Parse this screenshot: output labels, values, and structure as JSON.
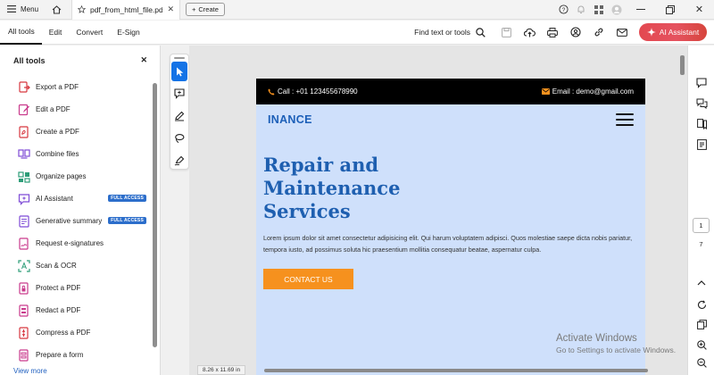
{
  "titlebar": {
    "menu_label": "Menu",
    "tab_title": "pdf_from_html_file.pdf",
    "create_label": "Create"
  },
  "toolbar": {
    "menu": [
      "All tools",
      "Edit",
      "Convert",
      "E-Sign"
    ],
    "find_label": "Find text or tools",
    "ai_label": "AI Assistant"
  },
  "left_panel": {
    "title": "All tools",
    "tools": [
      {
        "label": "Export a PDF",
        "icon": "export-pdf-icon",
        "color": "#d7373f"
      },
      {
        "label": "Edit a PDF",
        "icon": "edit-pdf-icon",
        "color": "#c93a8c"
      },
      {
        "label": "Create a PDF",
        "icon": "create-pdf-icon",
        "color": "#d7373f"
      },
      {
        "label": "Combine files",
        "icon": "combine-files-icon",
        "color": "#7e4bd6"
      },
      {
        "label": "Organize pages",
        "icon": "organize-pages-icon",
        "color": "#2d9d78"
      },
      {
        "label": "AI Assistant",
        "icon": "ai-assistant-icon",
        "color": "#7e4bd6",
        "badge": "FULL ACCESS"
      },
      {
        "label": "Generative summary",
        "icon": "generative-summary-icon",
        "color": "#7e4bd6",
        "badge": "FULL ACCESS"
      },
      {
        "label": "Request e-signatures",
        "icon": "request-esignatures-icon",
        "color": "#c93a8c"
      },
      {
        "label": "Scan & OCR",
        "icon": "scan-ocr-icon",
        "color": "#2d9d78"
      },
      {
        "label": "Protect a PDF",
        "icon": "protect-pdf-icon",
        "color": "#c93a8c"
      },
      {
        "label": "Redact a PDF",
        "icon": "redact-pdf-icon",
        "color": "#c93a8c"
      },
      {
        "label": "Compress a PDF",
        "icon": "compress-pdf-icon",
        "color": "#d7373f"
      },
      {
        "label": "Prepare a form",
        "icon": "prepare-form-icon",
        "color": "#c93a8c"
      }
    ],
    "view_more": "View more"
  },
  "document": {
    "phone": "Call : +01 123455678990",
    "email": "Email : demo@gmail.com",
    "brand": "INANCE",
    "hero_title": "Repair and Maintenance Services",
    "hero_text": "Lorem ipsum dolor sit amet consectetur adipisicing elit. Qui harum voluptatem adipisci. Quos molestiae saepe dicta nobis pariatur, tempora iusto, ad possimus soluta hic praesentium mollitia consequatur beatae, aspernatur culpa.",
    "cta": "CONTACT US",
    "page_size": "8.26 x 11.69 in"
  },
  "pagination": {
    "current": "1",
    "total": "7"
  },
  "watermark": {
    "line1": "Activate Windows",
    "line2": "Go to Settings to activate Windows."
  },
  "colors": {
    "accent": "#1473e6",
    "ai_button": "#e34850",
    "brand_blue": "#1e5fb0",
    "cta_orange": "#f6911e",
    "page_bg": "#cfe0fb"
  }
}
